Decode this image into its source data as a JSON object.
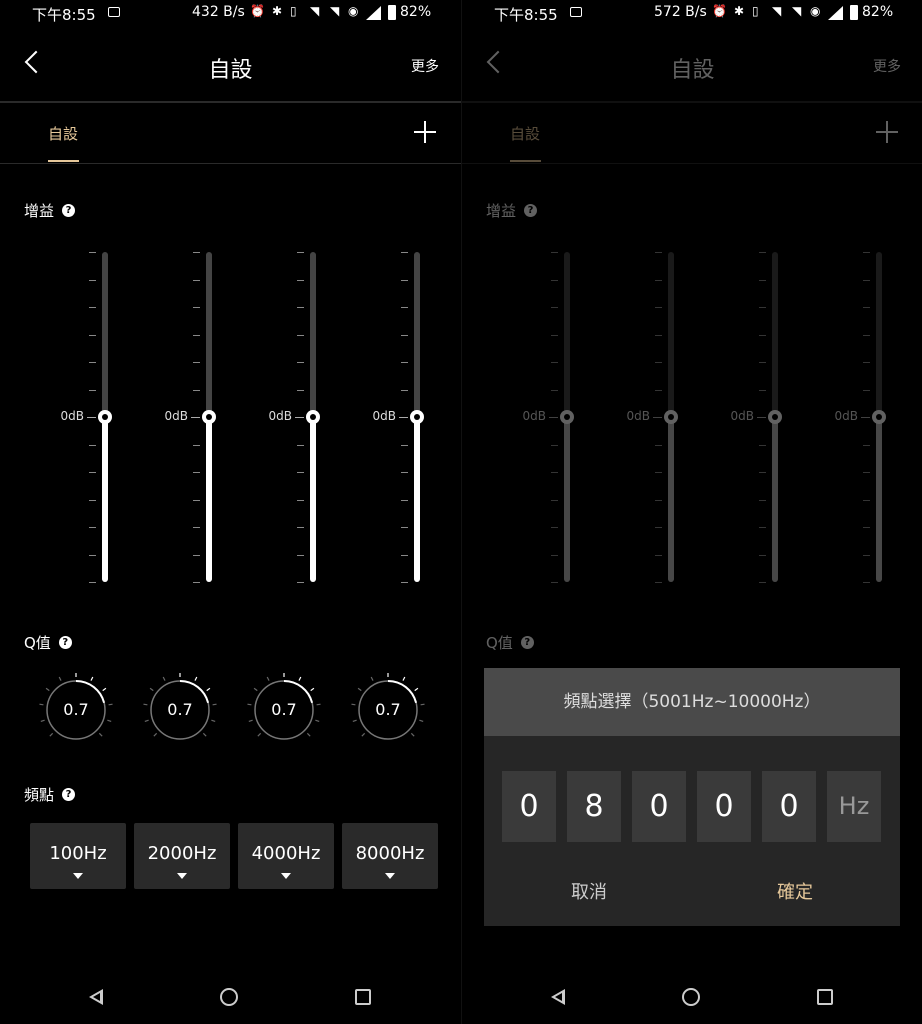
{
  "screens": [
    {
      "status": {
        "time": "下午8:55",
        "speed": "432 B/s",
        "battery": "82%"
      },
      "header": {
        "title": "自設",
        "more": "更多"
      },
      "tab": {
        "label": "自設"
      },
      "gain": {
        "label": "增益",
        "help": "?",
        "bands": [
          {
            "label": "0dB",
            "level": 0.5
          },
          {
            "label": "0dB",
            "level": 0.5
          },
          {
            "label": "0dB",
            "level": 0.5
          },
          {
            "label": "0dB",
            "level": 0.5
          }
        ]
      },
      "q": {
        "label": "Q值",
        "help": "?",
        "values": [
          "0.7",
          "0.7",
          "0.7",
          "0.7"
        ]
      },
      "freq": {
        "label": "頻點",
        "help": "?",
        "values": [
          "100Hz",
          "2000Hz",
          "4000Hz",
          "8000Hz"
        ]
      }
    },
    {
      "status": {
        "time": "下午8:55",
        "speed": "572 B/s",
        "battery": "82%"
      },
      "header": {
        "title": "自設",
        "more": "更多"
      },
      "tab": {
        "label": "自設"
      },
      "gain": {
        "label": "增益",
        "help": "?",
        "bands": [
          {
            "label": "0dB",
            "level": 0.5
          },
          {
            "label": "0dB",
            "level": 0.5
          },
          {
            "label": "0dB",
            "level": 0.5
          },
          {
            "label": "0dB",
            "level": 0.5
          }
        ]
      },
      "q": {
        "label": "Q值",
        "help": "?"
      },
      "dialog": {
        "title": "頻點選擇（5001Hz~10000Hz）",
        "digits": [
          "0",
          "8",
          "0",
          "0",
          "0"
        ],
        "unit": "Hz",
        "cancel": "取消",
        "confirm": "確定"
      }
    }
  ],
  "colors": {
    "accent": "#e6c89a",
    "background": "#000000",
    "button": "#2a2a2a"
  },
  "icons": {
    "back": "chevron-left-icon",
    "add": "plus-icon",
    "help": "question-icon",
    "nav": [
      "back-triangle-icon",
      "home-circle-icon",
      "recents-square-icon"
    ]
  }
}
